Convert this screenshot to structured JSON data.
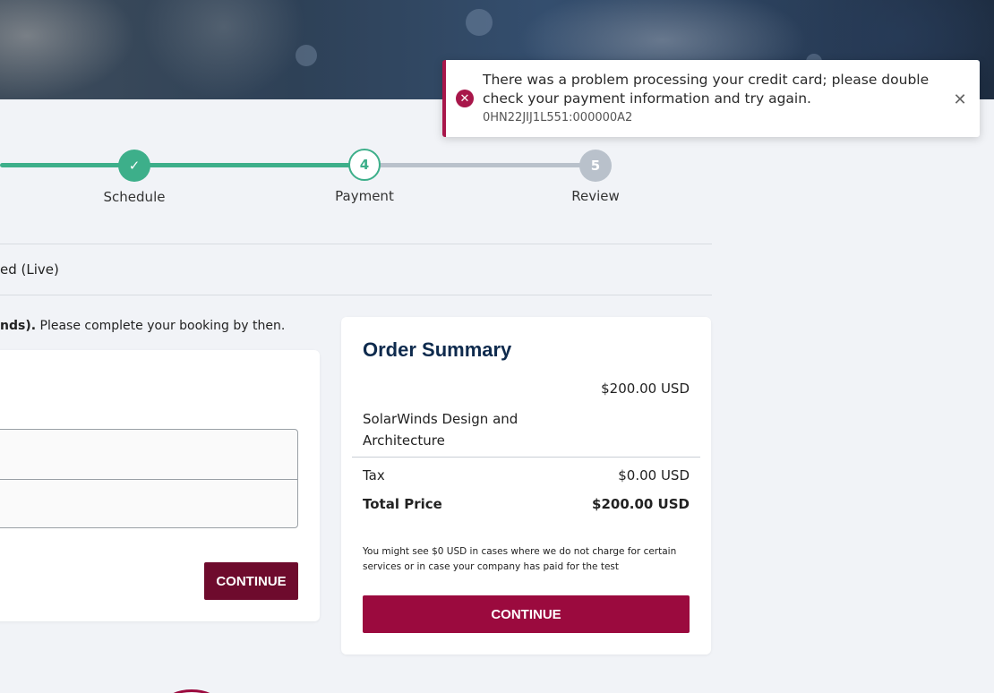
{
  "stepper": {
    "steps": [
      {
        "label": "Schedule",
        "marker": "✓",
        "state": "done"
      },
      {
        "label": "Payment",
        "marker": "4",
        "state": "active"
      },
      {
        "label": "Review",
        "marker": "5",
        "state": "todo"
      }
    ]
  },
  "session": {
    "type_text": "ed (Live)",
    "timer_bold": "nds).",
    "timer_rest": " Please complete your booking by then."
  },
  "form": {
    "continue_label": "CONTINUE"
  },
  "order_summary": {
    "title": "Order Summary",
    "product_price": "$200.00 USD",
    "product_name": "SolarWinds Design and Architecture",
    "tax_label": "Tax",
    "tax_value": "$0.00 USD",
    "total_label": "Total Price",
    "total_value": "$200.00 USD",
    "note": "You might see $0 USD in cases where we do not charge for certain services or in case your company has paid for the test",
    "continue_label": "CONTINUE"
  },
  "toast": {
    "message": "There was a problem processing your credit card; please double check your payment information and try again.",
    "code": "0HN22JIJ1L551:000000A2",
    "icon": "error-circle-icon",
    "close_icon": "close-icon"
  },
  "colors": {
    "accent_green": "#3daf8a",
    "brand_maroon": "#9b0a3e",
    "dark_maroon": "#6e0b2d",
    "title_navy": "#0e2a4d"
  }
}
